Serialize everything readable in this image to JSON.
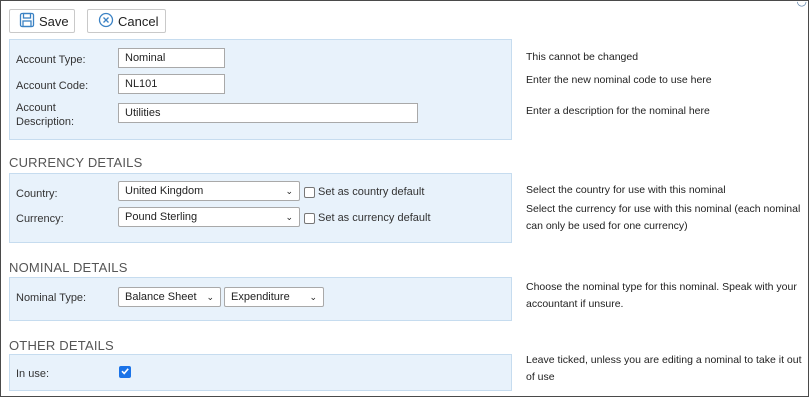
{
  "toolbar": {
    "save_label": "Save",
    "cancel_label": "Cancel"
  },
  "account": {
    "type_label": "Account Type:",
    "type_value": "Nominal",
    "code_label": "Account Code:",
    "code_value": "NL101",
    "description_label_line1": "Account",
    "description_label_line2": "Description:",
    "description_value": "Utilities"
  },
  "currency_details": {
    "heading": "CURRENCY DETAILS",
    "country_label": "Country:",
    "country_value": "United Kingdom",
    "country_default_label": "Set as country default",
    "currency_label": "Currency:",
    "currency_value": "Pound Sterling",
    "currency_default_label": "Set as currency default"
  },
  "nominal_details": {
    "heading": "NOMINAL DETAILS",
    "type_label": "Nominal Type:",
    "type_value": "Balance Sheet",
    "subtype_value": "Expenditure"
  },
  "other_details": {
    "heading": "OTHER DETAILS",
    "in_use_label": "In use:",
    "in_use_checked": true
  },
  "help": {
    "type": "This cannot be changed",
    "code": "Enter the new nominal code to use here",
    "description": "Enter a description for the nominal here",
    "country": "Select the country for use with this nominal",
    "currency": "Select the currency for use with this nominal (each nominal can only be used for one currency)",
    "nominal_type": "Choose the nominal type for this nominal. Speak with your accountant if unsure.",
    "in_use": "Leave ticked, unless you are editing a nominal to take it out of use"
  },
  "colors": {
    "accent": "#1a73e8",
    "panel_bg": "#e8f2fb",
    "panel_border": "#c6dcef",
    "icon_blue": "#3b82c4"
  }
}
